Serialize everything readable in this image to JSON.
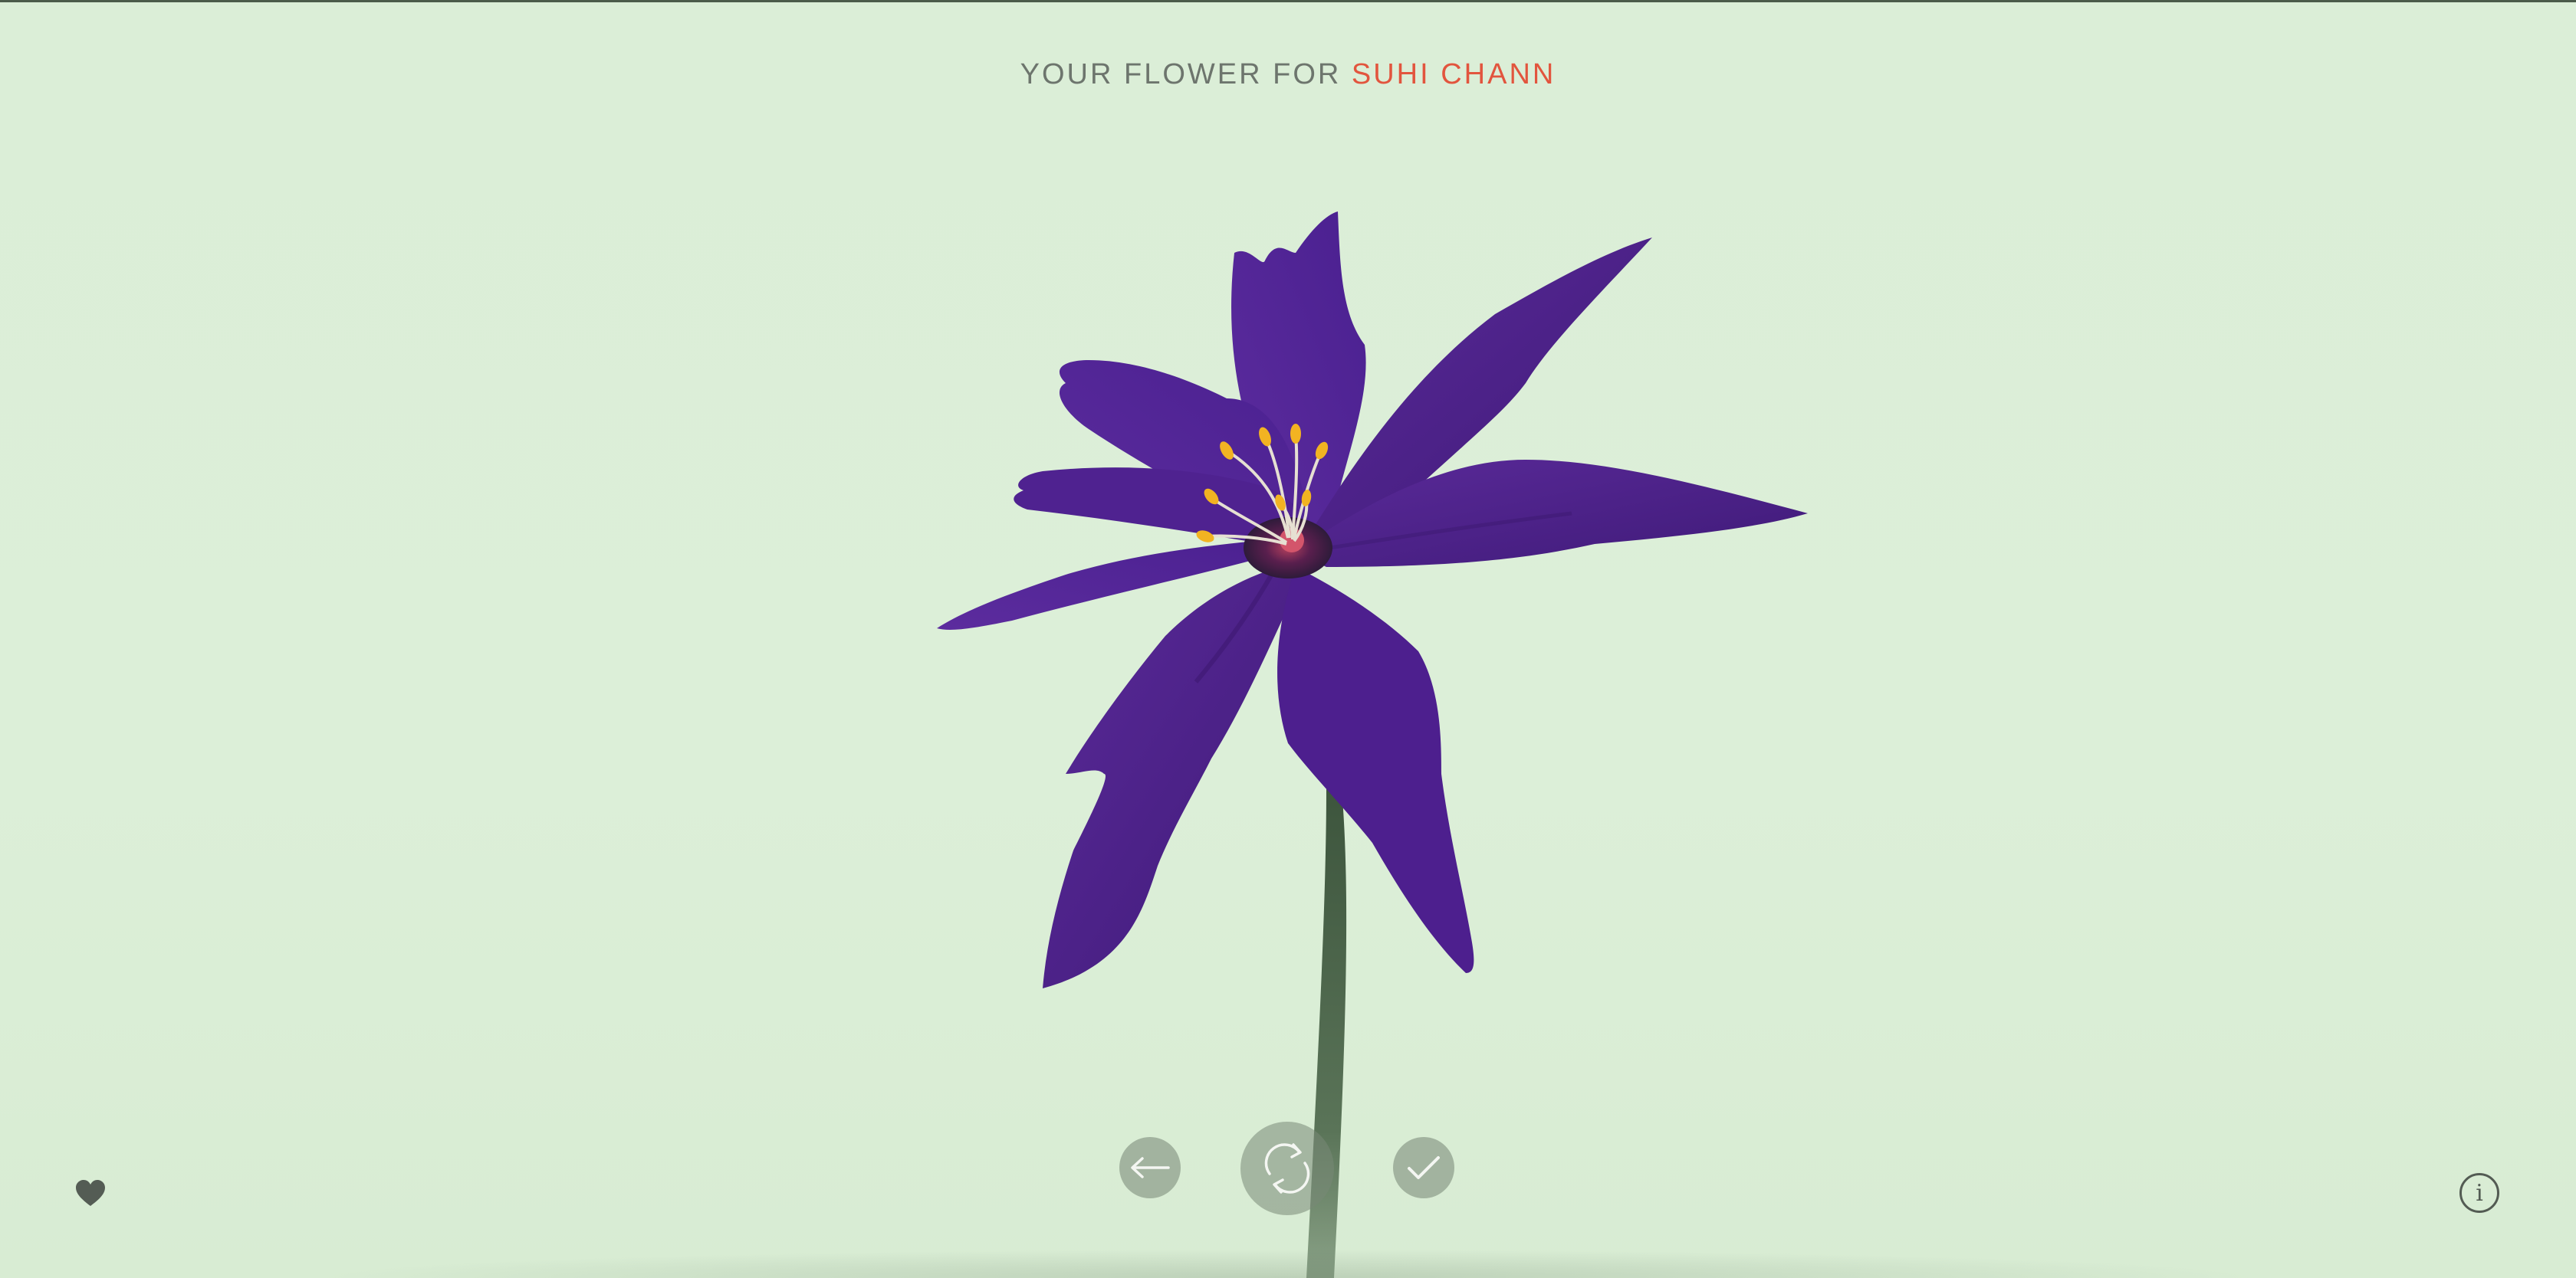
{
  "header": {
    "prefix": "YOUR FLOWER FOR",
    "recipient": "SUHI CHANN"
  },
  "colors": {
    "background": "#dcefd8",
    "accent": "#e2553e",
    "petal": "#4e1f8c",
    "stem": "#3f5a3f",
    "stamen": "#f2b322"
  },
  "controls": {
    "back_icon": "arrow-left-icon",
    "regenerate_icon": "refresh-icon",
    "accept_icon": "checkmark-icon"
  },
  "footer": {
    "favorite_icon": "heart-icon",
    "info_icon": "info-icon",
    "info_glyph": "i"
  }
}
